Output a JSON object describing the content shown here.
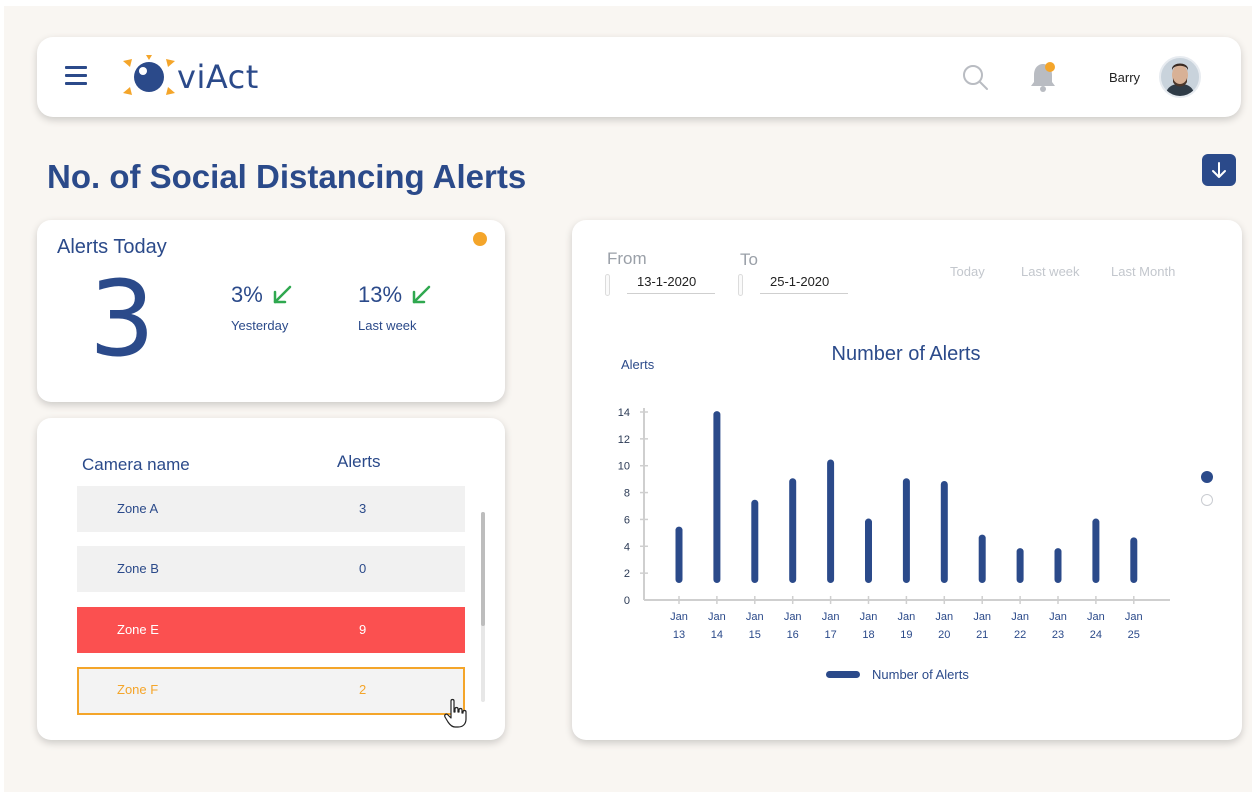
{
  "header": {
    "logo_text": "viAct",
    "user_name": "Barry"
  },
  "page": {
    "title": "No. of Social Distancing Alerts"
  },
  "alerts_today": {
    "title": "Alerts Today",
    "count": "3",
    "stats": [
      {
        "value": "3%",
        "label": "Yesterday"
      },
      {
        "value": "13%",
        "label": "Last week"
      }
    ]
  },
  "camera_table": {
    "col_name": "Camera name",
    "col_alerts": "Alerts",
    "rows": [
      {
        "name": "Zone A",
        "alerts": "3"
      },
      {
        "name": "Zone B",
        "alerts": "0"
      },
      {
        "name": "Zone E",
        "alerts": "9"
      },
      {
        "name": "Zone F",
        "alerts": "2"
      }
    ]
  },
  "filters": {
    "from_label": "From",
    "from_value": "13-1-2020",
    "to_label": "To",
    "to_value": "25-1-2020",
    "ranges": [
      "Today",
      "Last week",
      "Last Month"
    ]
  },
  "colors": {
    "primary": "#2b4a8a",
    "accent": "#f4a52a",
    "alert_row": "#fb5050",
    "trend_down": "#2fa84f"
  },
  "chart_data": {
    "type": "bar",
    "title": "Number of Alerts",
    "ylabel": "Alerts",
    "xlabel": "",
    "ylim": [
      0,
      14
    ],
    "yticks": [
      0,
      2,
      4,
      6,
      8,
      10,
      12,
      14
    ],
    "categories": [
      "Jan 13",
      "Jan 14",
      "Jan 15",
      "Jan 16",
      "Jan 17",
      "Jan 18",
      "Jan 19",
      "Jan 20",
      "Jan 21",
      "Jan 22",
      "Jan 23",
      "Jan 24",
      "Jan 25"
    ],
    "series": [
      {
        "name": "Number of Alerts",
        "values": [
          4.2,
          12.8,
          6.2,
          7.8,
          9.2,
          4.8,
          7.8,
          7.6,
          3.6,
          2.6,
          2.6,
          4.8,
          3.4
        ]
      }
    ],
    "legend_position": "bottom"
  }
}
